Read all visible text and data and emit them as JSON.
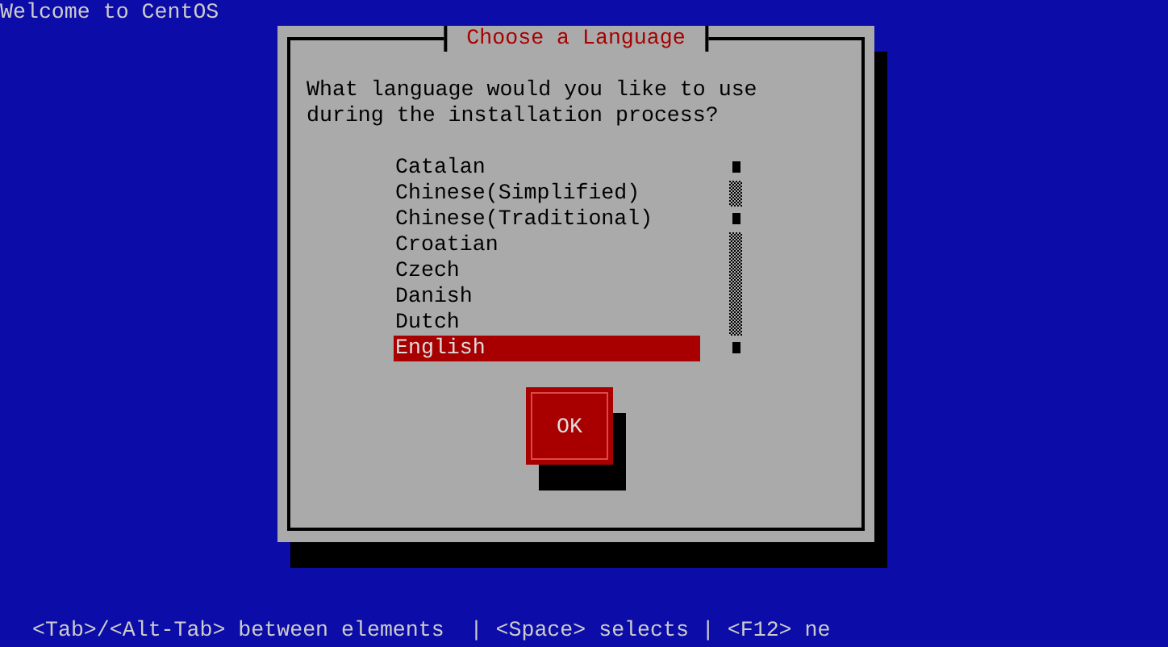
{
  "screen_title": "Welcome to CentOS",
  "dialog": {
    "title": "Choose a Language",
    "prompt": "What language would you like to use during the installation process?",
    "languages": [
      {
        "label": "Catalan",
        "selected": false
      },
      {
        "label": "Chinese(Simplified)",
        "selected": false
      },
      {
        "label": "Chinese(Traditional)",
        "selected": false
      },
      {
        "label": "Croatian",
        "selected": false
      },
      {
        "label": "Czech",
        "selected": false
      },
      {
        "label": "Danish",
        "selected": false
      },
      {
        "label": "Dutch",
        "selected": false
      },
      {
        "label": "English",
        "selected": true
      }
    ],
    "buttons": [
      "OK"
    ]
  },
  "status_bar": "<Tab>/<Alt-Tab> between elements  | <Space> selects | <F12> ne"
}
